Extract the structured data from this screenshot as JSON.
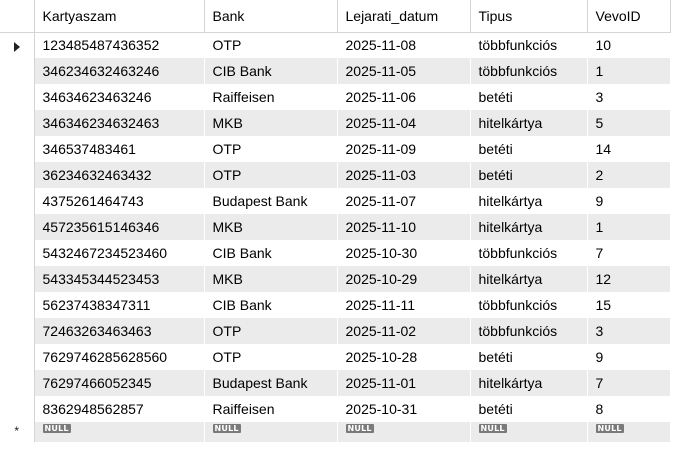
{
  "columns": [
    "Kartyaszam",
    "Bank",
    "Lejarati_datum",
    "Tipus",
    "VevoID"
  ],
  "rows": [
    [
      "123485487436352",
      "OTP",
      "2025-11-08",
      "többfunkciós",
      "10"
    ],
    [
      "346234632463246",
      "CIB Bank",
      "2025-11-05",
      "többfunkciós",
      "1"
    ],
    [
      "34634623463246",
      "Raiffeisen",
      "2025-11-06",
      "betéti",
      "3"
    ],
    [
      "346346234632463",
      "MKB",
      "2025-11-04",
      "hitelkártya",
      "5"
    ],
    [
      "346537483461",
      "OTP",
      "2025-11-09",
      "betéti",
      "14"
    ],
    [
      "36234632463432",
      "OTP",
      "2025-11-03",
      "betéti",
      "2"
    ],
    [
      "4375261464743",
      "Budapest Bank",
      "2025-11-07",
      "hitelkártya",
      "9"
    ],
    [
      "457235615146346",
      "MKB",
      "2025-11-10",
      "hitelkártya",
      "1"
    ],
    [
      "5432467234523460",
      "CIB Bank",
      "2025-10-30",
      "többfunkciós",
      "7"
    ],
    [
      "543345344523453",
      "MKB",
      "2025-10-29",
      "hitelkártya",
      "12"
    ],
    [
      "56237438347311",
      "CIB Bank",
      "2025-11-11",
      "többfunkciós",
      "15"
    ],
    [
      "72463263463463",
      "OTP",
      "2025-11-02",
      "többfunkciós",
      "3"
    ],
    [
      "7629746285628560",
      "OTP",
      "2025-10-28",
      "betéti",
      "9"
    ],
    [
      "76297466052345",
      "Budapest Bank",
      "2025-11-01",
      "hitelkártya",
      "7"
    ],
    [
      "8362948562857",
      "Raiffeisen",
      "2025-10-31",
      "betéti",
      "8"
    ]
  ],
  "new_row_value": "NULL",
  "new_row_marker": "*"
}
